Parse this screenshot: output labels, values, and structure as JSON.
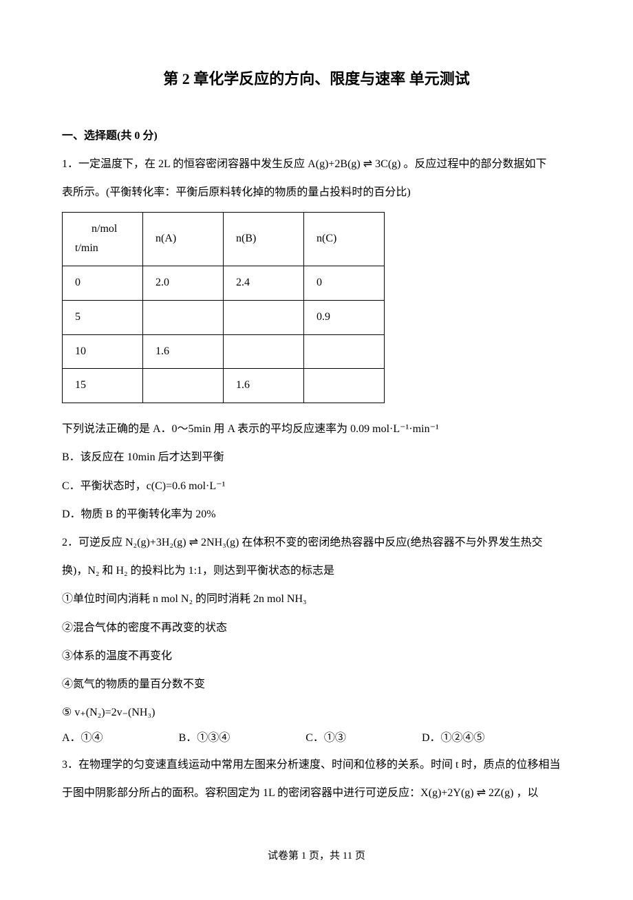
{
  "title": "第 2 章化学反应的方向、限度与速率  单元测试",
  "section1": {
    "heading": "一、选择题(共 0 分)"
  },
  "q1": {
    "intro_a": "1．一定温度下，在 2L 的恒容密闭容器中发生反应 A(g)+2B(g) ⇌ 3C(g) 。反应过程中的部分数据如下",
    "intro_b": "表所示。(平衡转化率：平衡后原料转化掉的物质的量占投料时的百分比)",
    "table": {
      "h1": "n/mol",
      "h1b": "t/min",
      "h2": "n(A)",
      "h3": "n(B)",
      "h4": "n(C)",
      "r1c1": "0",
      "r1c2": "2.0",
      "r1c3": "2.4",
      "r1c4": "0",
      "r2c1": "5",
      "r2c2": "",
      "r2c3": "",
      "r2c4": "0.9",
      "r3c1": "10",
      "r3c2": "1.6",
      "r3c3": "",
      "r3c4": "",
      "r4c1": "15",
      "r4c2": "",
      "r4c3": "1.6",
      "r4c4": ""
    },
    "stem": "下列说法正确的是 A．0～5min 用 A 表示的平均反应速率为 0.09 mol·L⁻¹·min⁻¹",
    "optB": "B．该反应在 10min 后才达到平衡",
    "optC": "C．平衡状态时，c(C)=0.6 mol·L⁻¹",
    "optD": "D．物质 B 的平衡转化率为 20%"
  },
  "q2": {
    "line1": "2．可逆反应 N₂(g)+3H₂(g) ⇌ 2NH₃(g) 在体积不变的密闭绝热容器中反应(绝热容器不与外界发生热交",
    "line2": "换)，N₂ 和 H₂ 的投料比为 1:1，则达到平衡状态的标志是",
    "c1": "①单位时间内消耗 n mol  N₂ 的同时消耗 2n mol  NH₃",
    "c2": "②混合气体的密度不再改变的状态",
    "c3": "③体系的温度不再变化",
    "c4": "④氮气的物质的量百分数不变",
    "c5": "⑤ v₊(N₂)=2v₋(NH₃)",
    "optA": "A．①④",
    "optB": "B．①③④",
    "optC": "C．①③",
    "optD": "D．①②④⑤"
  },
  "q3": {
    "line1": "3．在物理学的匀变速直线运动中常用左图来分析速度、时间和位移的关系。时间 t 时，质点的位移相当",
    "line2": "于图中阴影部分所占的面积。容积固定为 1L 的密闭容器中进行可逆反应：X(g)+2Y(g) ⇌ 2Z(g) ，以"
  },
  "footer": "试卷第 1 页，共 11 页"
}
